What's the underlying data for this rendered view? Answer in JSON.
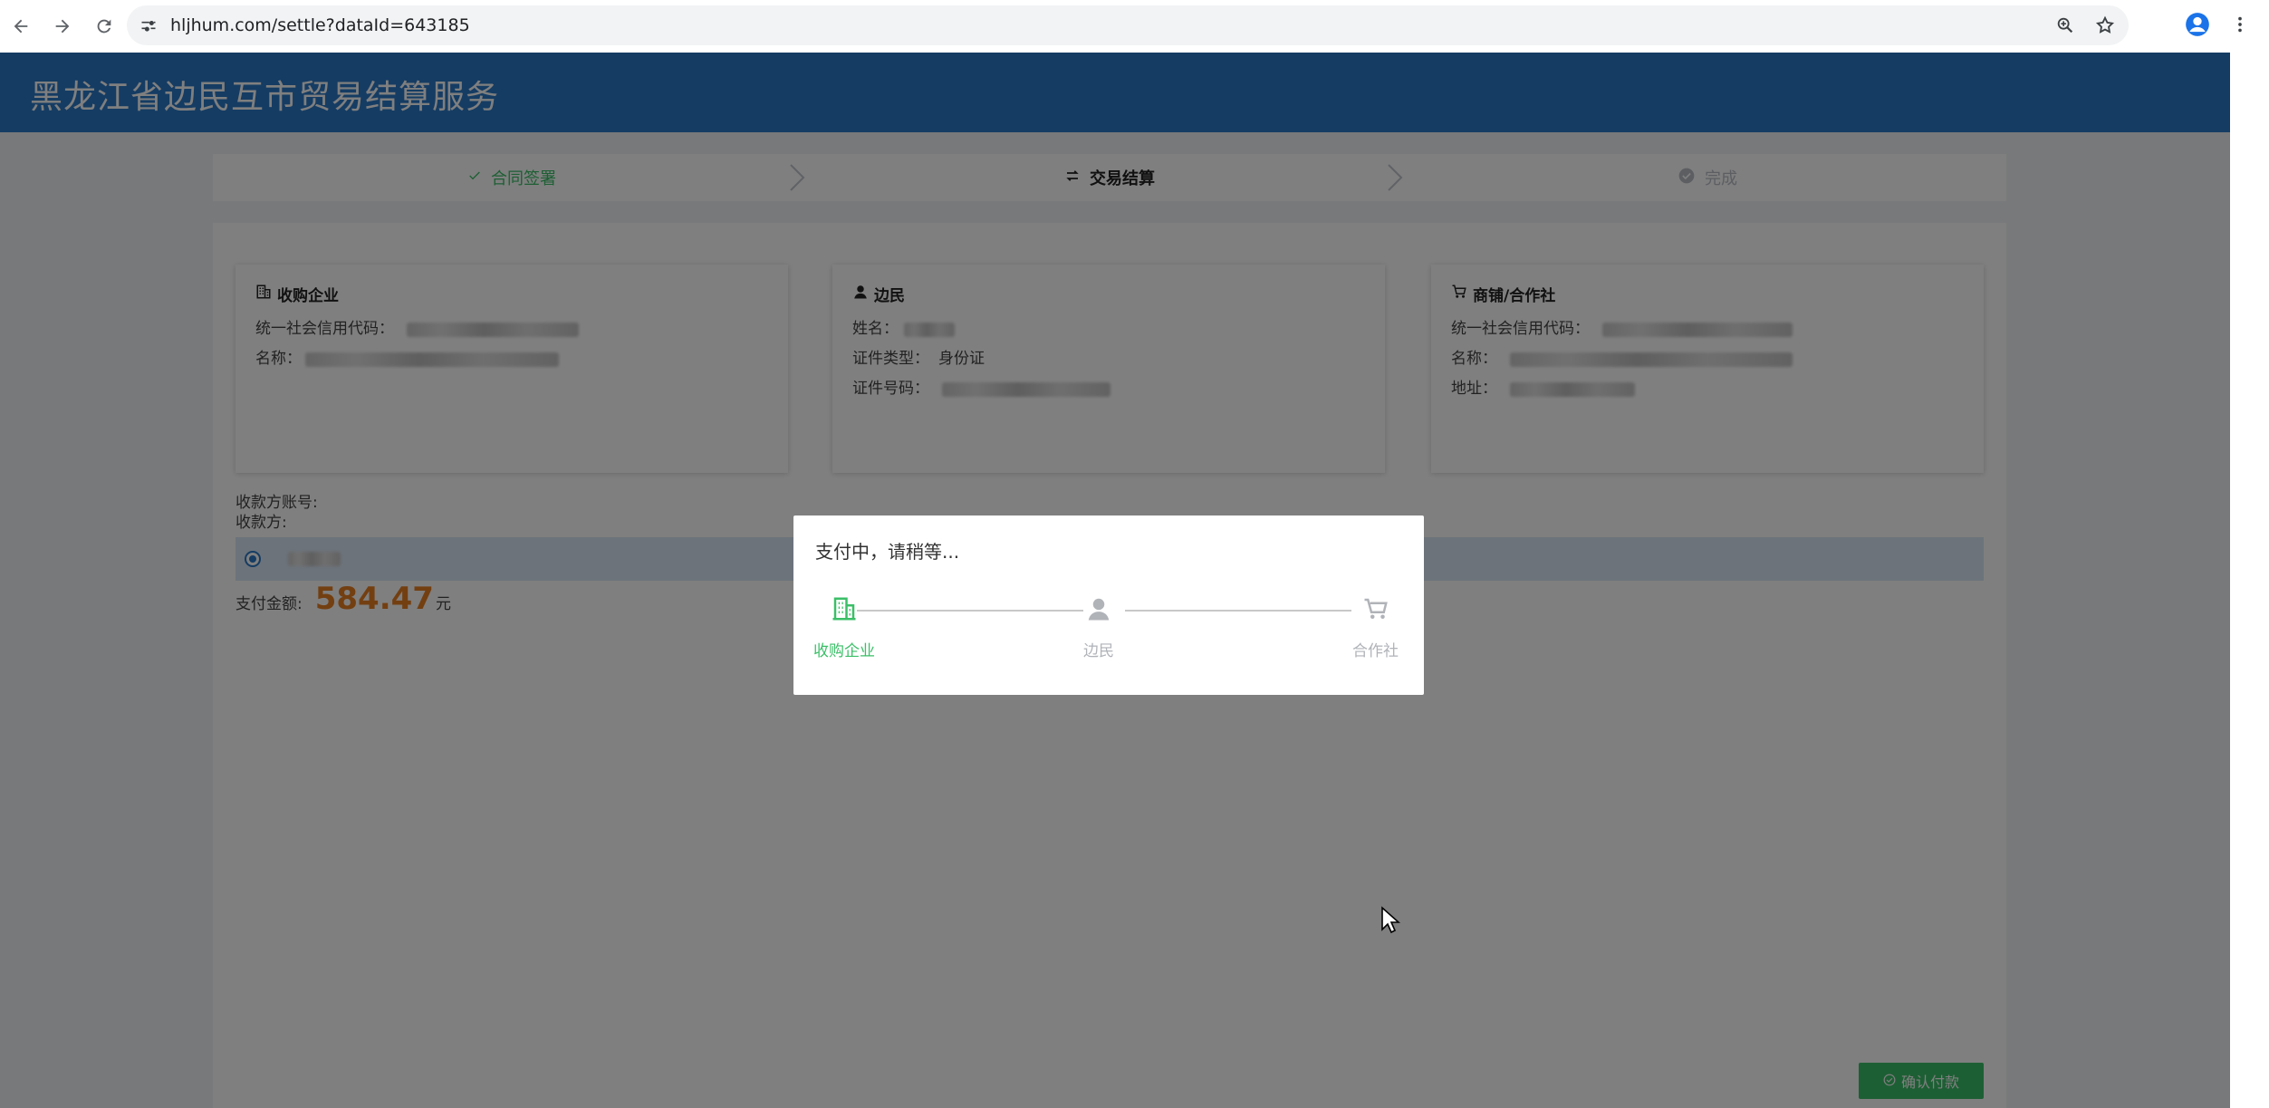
{
  "browser": {
    "url": "hljhum.com/settle?dataId=643185"
  },
  "app": {
    "title": "黑龙江省边民互市贸易结算服务"
  },
  "steps": [
    {
      "label": "合同签署",
      "state": "done"
    },
    {
      "label": "交易结算",
      "state": "active"
    },
    {
      "label": "完成",
      "state": "pending"
    }
  ],
  "cards": {
    "buyer": {
      "title": "收购企业",
      "credit_label": "统一社会信用代码：",
      "name_label": "名称："
    },
    "resident": {
      "title": "边民",
      "name_label": "姓名：",
      "id_type_label": "证件类型：",
      "id_type_value": "身份证",
      "id_no_label": "证件号码："
    },
    "shop": {
      "title": "商铺/合作社",
      "credit_label": "统一社会信用代码：",
      "name_label": "名称：",
      "address_label": "地址："
    }
  },
  "payee": {
    "account_label": "收款方账号:",
    "payee_label": "收款方:"
  },
  "payment": {
    "amount_label": "支付金额:",
    "amount": "584.47",
    "unit": "元"
  },
  "confirm_button": "确认付款",
  "modal": {
    "title": "支付中，请稍等...",
    "nodes": [
      {
        "label": "收购企业",
        "state": "active"
      },
      {
        "label": "边民",
        "state": "pending"
      },
      {
        "label": "合作社",
        "state": "pending"
      }
    ]
  },
  "colors": {
    "header": "#2b79c7",
    "success": "#3bbf68",
    "amount": "#e67e22",
    "selected_row": "#d9e7f7"
  }
}
